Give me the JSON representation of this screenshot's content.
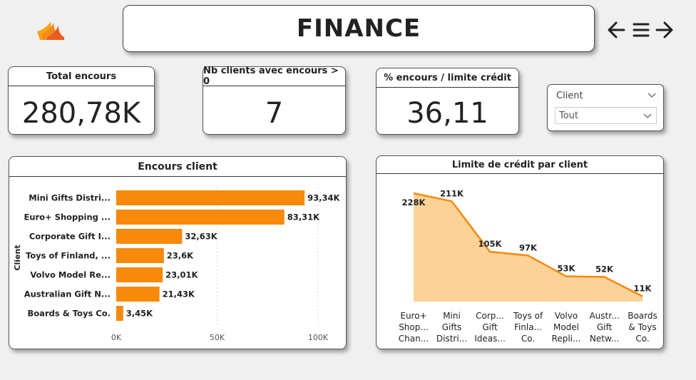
{
  "header": {
    "title": "FINANCE",
    "logo_icon": "flame-logo-icon",
    "nav": {
      "back_icon": "arrow-left-icon",
      "menu_icon": "hamburger-menu-icon",
      "forward_icon": "arrow-right-icon"
    }
  },
  "kpis": [
    {
      "label": "Total encours",
      "value": "280,78K"
    },
    {
      "label": "Nb clients avec encours > 0",
      "value": "7"
    },
    {
      "label": "% encours / limite crédit",
      "value": "36,11"
    }
  ],
  "slicer": {
    "title": "Client",
    "selected": "Tout"
  },
  "colors": {
    "accent": "#f7890c",
    "area_fill": "#fdd298"
  },
  "chart_data": [
    {
      "type": "bar",
      "orientation": "horizontal",
      "title": "Encours client",
      "ylabel": "Client",
      "xlabel": "",
      "categories": [
        "Mini Gifts Distri...",
        "Euro+ Shopping ...",
        "Corporate Gift I...",
        "Toys of Finland, ...",
        "Volvo Model Re...",
        "Australian Gift N...",
        "Boards & Toys Co."
      ],
      "values": [
        93.34,
        83.31,
        32.63,
        23.6,
        23.01,
        21.43,
        3.45
      ],
      "value_labels": [
        "93,34K",
        "83,31K",
        "32,63K",
        "23,6K",
        "23,01K",
        "21,43K",
        "3,45K"
      ],
      "xticks": [
        "0K",
        "50K",
        "100K"
      ],
      "xtick_values": [
        0,
        50,
        100
      ],
      "xlim": [
        0,
        100
      ],
      "unit": "K",
      "grid": true
    },
    {
      "type": "area",
      "title": "Limite de crédit par client",
      "categories": [
        [
          "Euro+",
          "Shop...",
          "Chan..."
        ],
        [
          "Mini",
          "Gifts",
          "Distri..."
        ],
        [
          "Corp...",
          "Gift",
          "Ideas..."
        ],
        [
          "Toys of",
          "Finla...",
          "Co."
        ],
        [
          "Volvo",
          "Model",
          "Repli..."
        ],
        [
          "Austr...",
          "Gift",
          "Netw..."
        ],
        [
          "Boards",
          "& Toys",
          "Co."
        ]
      ],
      "values": [
        228,
        211,
        105,
        97,
        53,
        52,
        11
      ],
      "value_labels": [
        "228K",
        "211K",
        "105K",
        "97K",
        "53K",
        "52K",
        "11K"
      ],
      "unit": "K",
      "ylim": [
        0,
        228
      ]
    }
  ]
}
